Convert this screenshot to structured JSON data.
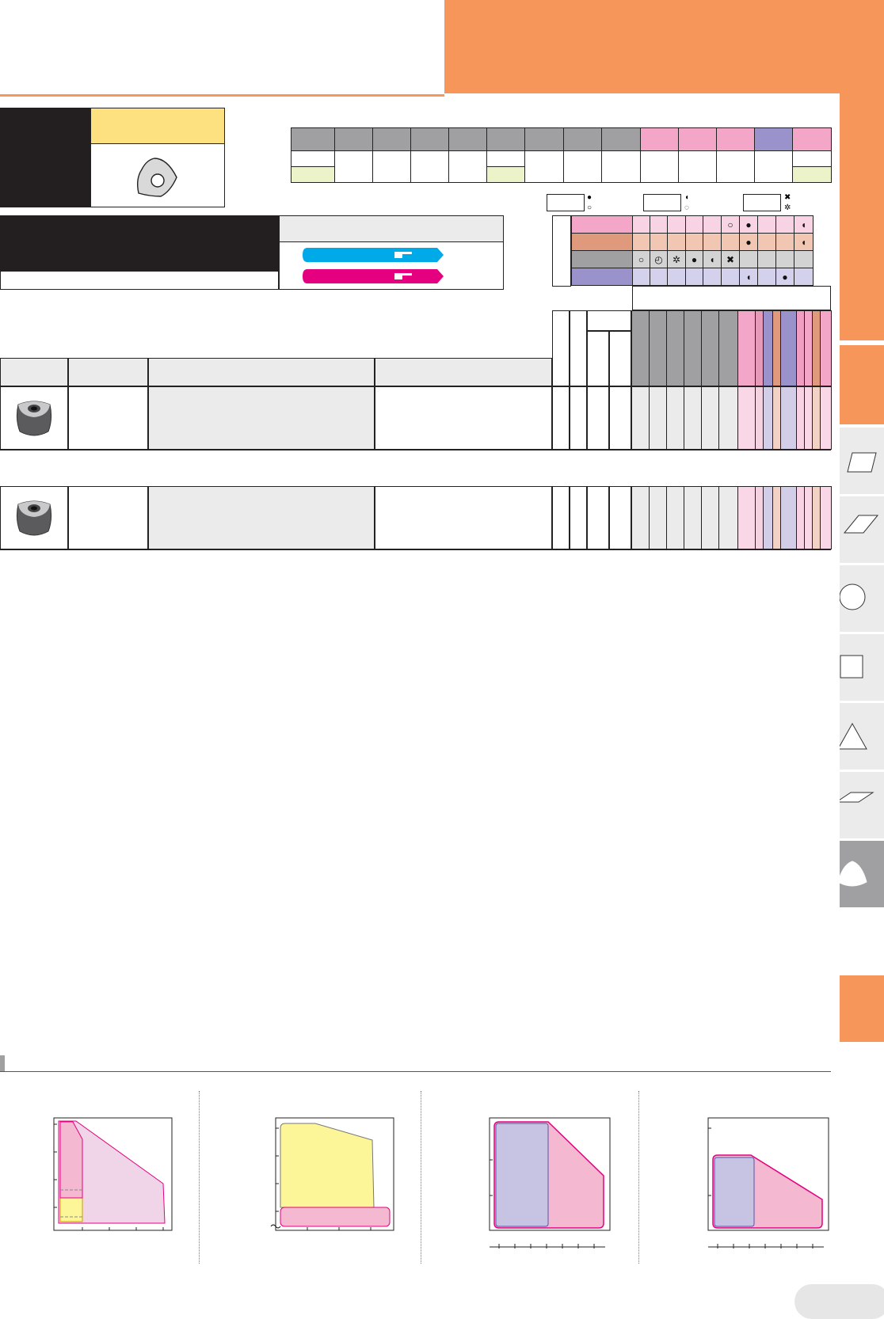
{
  "colors": {
    "orange": "#f7965a",
    "pink": "#f4a6c8",
    "magenta": "#e4007f",
    "cyan": "#00a9e8",
    "violet": "#9a93cb",
    "salmon": "#df9a7e",
    "grey": "#a0a0a2",
    "yellow": "#fde07f",
    "lightgreen": "#ecf3c8",
    "chartYellow": "#fdf698",
    "chartPink": "#f4b8d0",
    "chartViolet": "#c6c3e3"
  },
  "legend_symbols": [
    "●",
    "○",
    "◖",
    "◌",
    "✖",
    "✲"
  ],
  "tabs": {
    "icons": [
      "parallelogram-small-icon",
      "parallelogram-wide-icon",
      "circle-icon",
      "square-icon",
      "triangle-icon",
      "rhombus-icon",
      "trigon-icon"
    ]
  },
  "grade_table": {
    "row_symbols": {
      "row1": [
        "",
        "",
        "",
        "",
        "",
        "○",
        "●",
        "",
        "",
        "◖"
      ],
      "row2": [
        "",
        "",
        "",
        "",
        "",
        "",
        "●",
        "",
        "",
        "◖"
      ],
      "row3": [
        "○",
        "◴",
        "✲",
        "●",
        "◖",
        "✖",
        "",
        "",
        "",
        ""
      ],
      "row4": [
        "",
        "",
        "",
        "",
        "",
        "",
        "◖",
        "",
        "●",
        ""
      ]
    }
  }
}
